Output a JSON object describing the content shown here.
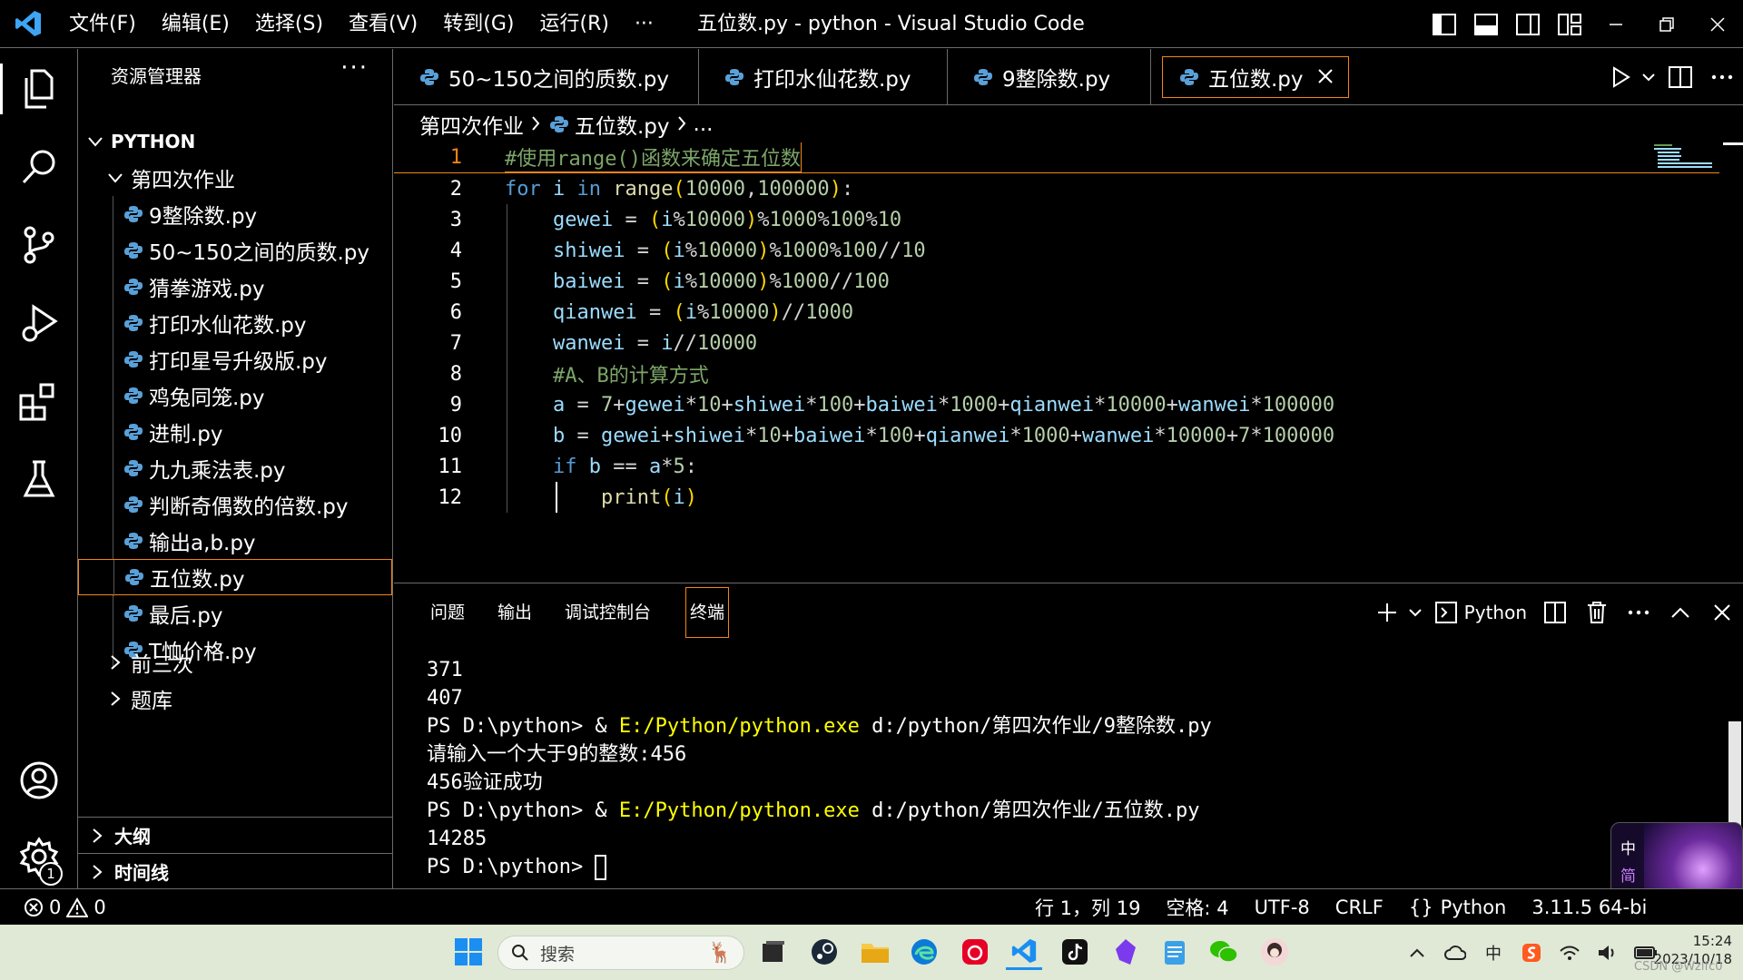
{
  "window": {
    "title": "五位数.py - python - Visual Studio Code",
    "menu": [
      "文件(F)",
      "编辑(E)",
      "选择(S)",
      "查看(V)",
      "转到(G)",
      "运行(R)",
      "···"
    ]
  },
  "sidebar": {
    "header": "资源管理器",
    "more": "···",
    "root": "PYTHON",
    "folder": "第四次作业",
    "files": [
      "9整除数.py",
      "50~150之间的质数.py",
      "猜拳游戏.py",
      "打印水仙花数.py",
      "打印星号升级版.py",
      "鸡兔同笼.py",
      "进制.py",
      "九九乘法表.py",
      "判断奇偶数的倍数.py",
      "输出a,b.py",
      "五位数.py",
      "最后.py",
      "T恤价格.py"
    ],
    "selected_file": "五位数.py",
    "collapsed_folders": [
      "前三次",
      "题库"
    ],
    "sections": [
      "大纲",
      "时间线"
    ],
    "settings_badge": "1"
  },
  "tabs": [
    {
      "label": "50~150之间的质数.py",
      "active": false
    },
    {
      "label": "打印水仙花数.py",
      "active": false
    },
    {
      "label": "9整除数.py",
      "active": false
    },
    {
      "label": "五位数.py",
      "active": true
    }
  ],
  "breadcrumb": {
    "folder": "第四次作业",
    "file": "五位数.py",
    "tail": "..."
  },
  "code": {
    "current_line": 1,
    "lines": [
      {
        "n": "1",
        "tokens": [
          [
            "cmt",
            "#使用range()函数来确定五位数"
          ]
        ]
      },
      {
        "n": "2",
        "tokens": [
          [
            "kw",
            "for "
          ],
          [
            "var",
            "i "
          ],
          [
            "kw",
            "in "
          ],
          [
            "fn",
            "range"
          ],
          [
            "paren",
            "("
          ],
          [
            "num",
            "10000"
          ],
          [
            "op",
            ","
          ],
          [
            "num",
            "100000"
          ],
          [
            "paren",
            ")"
          ],
          [
            "op",
            ":"
          ]
        ]
      },
      {
        "n": "3",
        "tokens": [
          [
            "op",
            "    "
          ],
          [
            "var",
            "gewei "
          ],
          [
            "op",
            "= "
          ],
          [
            "paren",
            "("
          ],
          [
            "var",
            "i"
          ],
          [
            "op",
            "%"
          ],
          [
            "num",
            "10000"
          ],
          [
            "paren",
            ")"
          ],
          [
            "op",
            "%"
          ],
          [
            "num",
            "1000"
          ],
          [
            "op",
            "%"
          ],
          [
            "num",
            "100"
          ],
          [
            "op",
            "%"
          ],
          [
            "num",
            "10"
          ]
        ]
      },
      {
        "n": "4",
        "tokens": [
          [
            "op",
            "    "
          ],
          [
            "var",
            "shiwei "
          ],
          [
            "op",
            "= "
          ],
          [
            "paren",
            "("
          ],
          [
            "var",
            "i"
          ],
          [
            "op",
            "%"
          ],
          [
            "num",
            "10000"
          ],
          [
            "paren",
            ")"
          ],
          [
            "op",
            "%"
          ],
          [
            "num",
            "1000"
          ],
          [
            "op",
            "%"
          ],
          [
            "num",
            "100"
          ],
          [
            "op",
            "//"
          ],
          [
            "num",
            "10"
          ]
        ]
      },
      {
        "n": "5",
        "tokens": [
          [
            "op",
            "    "
          ],
          [
            "var",
            "baiwei "
          ],
          [
            "op",
            "= "
          ],
          [
            "paren",
            "("
          ],
          [
            "var",
            "i"
          ],
          [
            "op",
            "%"
          ],
          [
            "num",
            "10000"
          ],
          [
            "paren",
            ")"
          ],
          [
            "op",
            "%"
          ],
          [
            "num",
            "1000"
          ],
          [
            "op",
            "//"
          ],
          [
            "num",
            "100"
          ]
        ]
      },
      {
        "n": "6",
        "tokens": [
          [
            "op",
            "    "
          ],
          [
            "var",
            "qianwei "
          ],
          [
            "op",
            "= "
          ],
          [
            "paren",
            "("
          ],
          [
            "var",
            "i"
          ],
          [
            "op",
            "%"
          ],
          [
            "num",
            "10000"
          ],
          [
            "paren",
            ")"
          ],
          [
            "op",
            "//"
          ],
          [
            "num",
            "1000"
          ]
        ]
      },
      {
        "n": "7",
        "tokens": [
          [
            "op",
            "    "
          ],
          [
            "var",
            "wanwei "
          ],
          [
            "op",
            "= "
          ],
          [
            "var",
            "i"
          ],
          [
            "op",
            "//"
          ],
          [
            "num",
            "10000"
          ]
        ]
      },
      {
        "n": "8",
        "tokens": [
          [
            "op",
            "    "
          ],
          [
            "cmt",
            "#A、B的计算方式"
          ]
        ]
      },
      {
        "n": "9",
        "tokens": [
          [
            "op",
            "    "
          ],
          [
            "var",
            "a "
          ],
          [
            "op",
            "= "
          ],
          [
            "num",
            "7"
          ],
          [
            "op",
            "+"
          ],
          [
            "var",
            "gewei"
          ],
          [
            "op",
            "*"
          ],
          [
            "num",
            "10"
          ],
          [
            "op",
            "+"
          ],
          [
            "var",
            "shiwei"
          ],
          [
            "op",
            "*"
          ],
          [
            "num",
            "100"
          ],
          [
            "op",
            "+"
          ],
          [
            "var",
            "baiwei"
          ],
          [
            "op",
            "*"
          ],
          [
            "num",
            "1000"
          ],
          [
            "op",
            "+"
          ],
          [
            "var",
            "qianwei"
          ],
          [
            "op",
            "*"
          ],
          [
            "num",
            "10000"
          ],
          [
            "op",
            "+"
          ],
          [
            "var",
            "wanwei"
          ],
          [
            "op",
            "*"
          ],
          [
            "num",
            "100000"
          ]
        ]
      },
      {
        "n": "10",
        "tokens": [
          [
            "op",
            "    "
          ],
          [
            "var",
            "b "
          ],
          [
            "op",
            "= "
          ],
          [
            "var",
            "gewei"
          ],
          [
            "op",
            "+"
          ],
          [
            "var",
            "shiwei"
          ],
          [
            "op",
            "*"
          ],
          [
            "num",
            "10"
          ],
          [
            "op",
            "+"
          ],
          [
            "var",
            "baiwei"
          ],
          [
            "op",
            "*"
          ],
          [
            "num",
            "100"
          ],
          [
            "op",
            "+"
          ],
          [
            "var",
            "qianwei"
          ],
          [
            "op",
            "*"
          ],
          [
            "num",
            "1000"
          ],
          [
            "op",
            "+"
          ],
          [
            "var",
            "wanwei"
          ],
          [
            "op",
            "*"
          ],
          [
            "num",
            "10000"
          ],
          [
            "op",
            "+"
          ],
          [
            "num",
            "7"
          ],
          [
            "op",
            "*"
          ],
          [
            "num",
            "100000"
          ]
        ]
      },
      {
        "n": "11",
        "tokens": [
          [
            "op",
            "    "
          ],
          [
            "kw",
            "if "
          ],
          [
            "var",
            "b "
          ],
          [
            "op",
            "== "
          ],
          [
            "var",
            "a"
          ],
          [
            "op",
            "*"
          ],
          [
            "num",
            "5"
          ],
          [
            "op",
            ":"
          ]
        ]
      },
      {
        "n": "12",
        "tokens": [
          [
            "op",
            "        "
          ],
          [
            "fn",
            "print"
          ],
          [
            "paren",
            "("
          ],
          [
            "var",
            "i"
          ],
          [
            "paren",
            ")"
          ]
        ]
      }
    ]
  },
  "panel": {
    "tabs": [
      "问题",
      "输出",
      "调试控制台",
      "终端"
    ],
    "active_tab": "终端",
    "terminal_profile": "Python",
    "terminal_lines": [
      [
        [
          "",
          "371"
        ]
      ],
      [
        [
          "",
          "407"
        ]
      ],
      [
        [
          "",
          "PS D:\\python> & "
        ],
        [
          "t-yellow",
          "E:/Python/python.exe"
        ],
        [
          "",
          " d:/python/第四次作业/9整除数.py"
        ]
      ],
      [
        [
          "",
          "请输入一个大于9的整数:456"
        ]
      ],
      [
        [
          "",
          "456验证成功"
        ]
      ],
      [
        [
          "",
          "PS D:\\python> & "
        ],
        [
          "t-yellow",
          "E:/Python/python.exe"
        ],
        [
          "",
          " d:/python/第四次作业/五位数.py"
        ]
      ],
      [
        [
          "",
          "14285"
        ]
      ],
      [
        [
          "",
          "PS D:\\python> "
        ]
      ]
    ]
  },
  "statusbar": {
    "errors": "0",
    "warnings": "0",
    "position": "行 1，列 19",
    "spaces": "空格: 4",
    "encoding": "UTF-8",
    "eol": "CRLF",
    "language": "Python",
    "interpreter": "3.11.5 64-bi"
  },
  "ime": {
    "chars": [
      "中",
      "简"
    ]
  },
  "taskbar": {
    "search_placeholder": "搜索",
    "time": "15:24",
    "date": "2023/10/18",
    "tray_ime": "中"
  },
  "watermark": "CSDN @Wzlfc0"
}
